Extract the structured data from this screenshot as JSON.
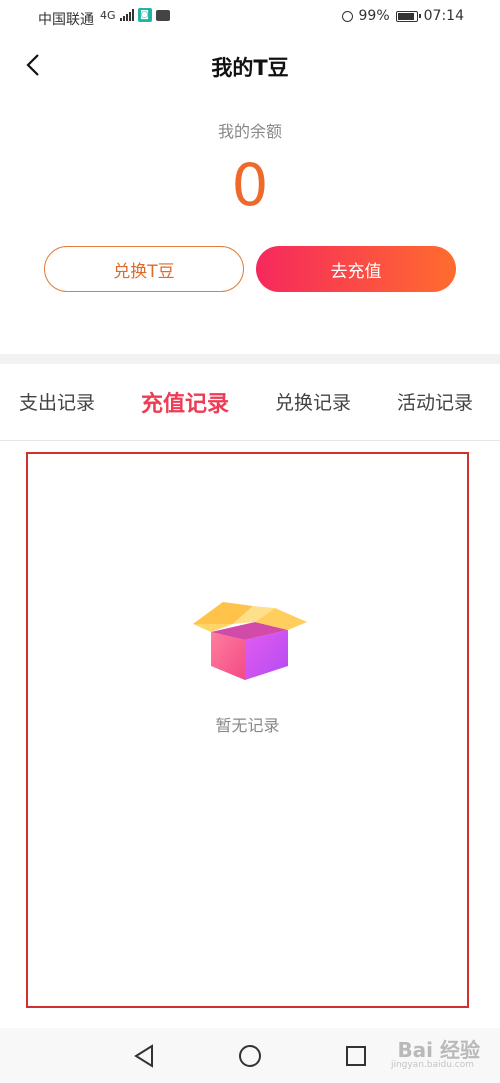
{
  "status_bar": {
    "carrier": "中国联通",
    "network": "4G",
    "battery": "99%",
    "battery_level": 0.99,
    "time": "07:14"
  },
  "header": {
    "title": "我的T豆",
    "back_icon": "chevron-left-icon"
  },
  "balance": {
    "label": "我的余额",
    "value": "0"
  },
  "actions": {
    "exchange_label": "兑换T豆",
    "recharge_label": "去充值",
    "recharge_gradient": [
      "#f6285e",
      "#ff6c2e"
    ],
    "exchange_color": "#e06a2a"
  },
  "tabs": [
    {
      "label": "支出记录",
      "active": false
    },
    {
      "label": "充值记录",
      "active": true
    },
    {
      "label": "兑换记录",
      "active": false
    },
    {
      "label": "活动记录",
      "active": false
    }
  ],
  "empty_state": {
    "icon": "open-box-icon",
    "text": "暂无记录"
  },
  "nav_bar": {
    "back": "triangle-back-icon",
    "home": "circle-home-icon",
    "recent": "square-recent-icon"
  },
  "watermark": {
    "text": "Bai 经验",
    "sub": "jingyan.baidu.com"
  }
}
